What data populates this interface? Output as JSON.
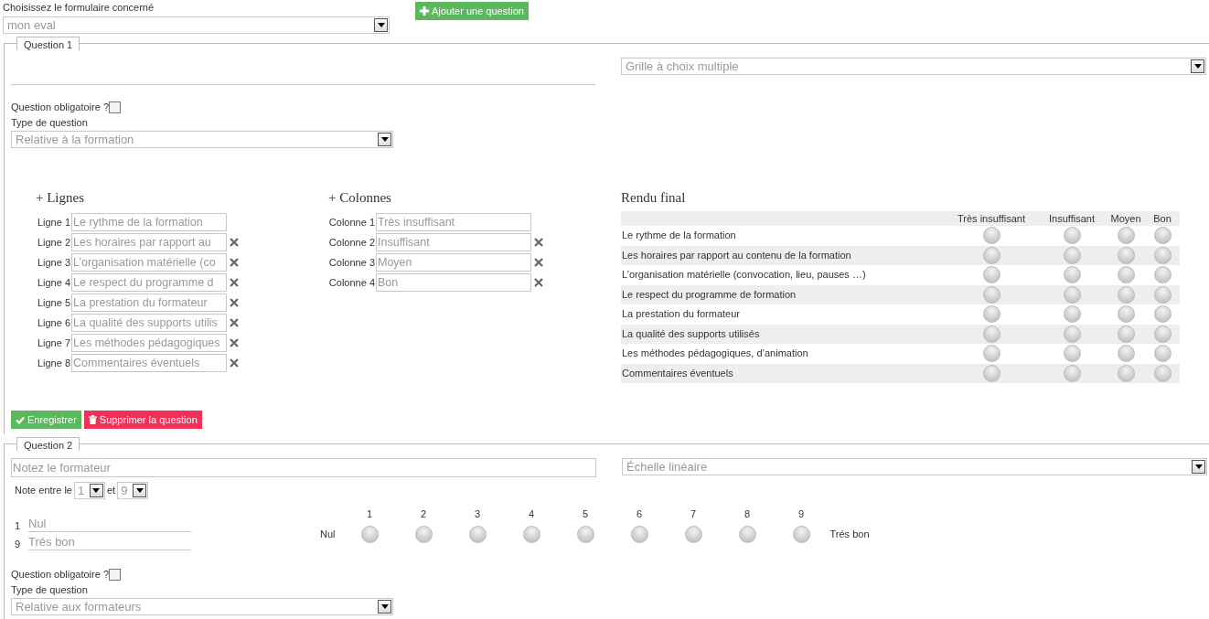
{
  "form_select": {
    "label": "Choisissez le formulaire concerné",
    "value": "mon eval"
  },
  "add_button": {
    "label": "Ajouter une question"
  },
  "questions": [
    {
      "legend": "Question 1",
      "kind": "grid",
      "type_select": "Grille à choix multiple",
      "required": {
        "label": "Question obligatoire ?",
        "checked": false
      },
      "category": {
        "label": "Type de question",
        "value": "Relative à la formation"
      },
      "lines": {
        "heading": "+ Lignes",
        "items": [
          {
            "label": "Ligne 1",
            "value": "Le rythme de la formation",
            "removable": false
          },
          {
            "label": "Ligne 2",
            "value": "Les horaires par rapport au",
            "removable": true
          },
          {
            "label": "Ligne 3",
            "value": "L’organisation matérielle (co",
            "removable": true
          },
          {
            "label": "Ligne 4",
            "value": "Le respect du programme d",
            "removable": true
          },
          {
            "label": "Ligne 5",
            "value": "La prestation du formateur",
            "removable": true
          },
          {
            "label": "Ligne 6",
            "value": "La qualité des supports utilis",
            "removable": true
          },
          {
            "label": "Ligne 7",
            "value": "Les méthodes pédagogiques",
            "removable": true
          },
          {
            "label": "Ligne 8",
            "value": "Commentaires éventuels",
            "removable": true
          }
        ]
      },
      "columns": {
        "heading": "+ Colonnes",
        "items": [
          {
            "label": "Colonne 1",
            "value": "Très insuffisant",
            "removable": false
          },
          {
            "label": "Colonne 2",
            "value": "Insuffisant",
            "removable": true
          },
          {
            "label": "Colonne 3",
            "value": "Moyen",
            "removable": true
          },
          {
            "label": "Colonne 4",
            "value": "Bon",
            "removable": true
          }
        ]
      },
      "preview": {
        "heading": "Rendu final",
        "columns": [
          "Très insuffisant",
          "Insuffisant",
          "Moyen",
          "Bon"
        ],
        "rows": [
          {
            "label": "Le rythme de la formation",
            "choices": [
              {
                "selected": false
              },
              {
                "selected": false
              },
              {
                "selected": false
              },
              {
                "selected": false
              }
            ]
          },
          {
            "label": "Les horaires par rapport au contenu de la formation",
            "choices": [
              {
                "selected": false
              },
              {
                "selected": false
              },
              {
                "selected": false
              },
              {
                "selected": false
              }
            ]
          },
          {
            "label": "L’organisation matérielle (convocation, lieu, pauses …)",
            "choices": [
              {
                "selected": false
              },
              {
                "selected": false
              },
              {
                "selected": false
              },
              {
                "selected": false
              }
            ]
          },
          {
            "label": "Le respect du programme de formation",
            "choices": [
              {
                "selected": false
              },
              {
                "selected": false
              },
              {
                "selected": false
              },
              {
                "selected": false
              }
            ]
          },
          {
            "label": "La prestation du formateur",
            "choices": [
              {
                "selected": false
              },
              {
                "selected": false
              },
              {
                "selected": false
              },
              {
                "selected": false
              }
            ]
          },
          {
            "label": "La qualité des supports utilisés",
            "choices": [
              {
                "selected": false
              },
              {
                "selected": false
              },
              {
                "selected": false
              },
              {
                "selected": false
              }
            ]
          },
          {
            "label": "Les méthodes pédagogiques, d’animation",
            "choices": [
              {
                "selected": false
              },
              {
                "selected": false
              },
              {
                "selected": false
              },
              {
                "selected": false
              }
            ]
          },
          {
            "label": "Commentaires éventuels",
            "choices": [
              {
                "selected": false
              },
              {
                "selected": false
              },
              {
                "selected": false
              },
              {
                "selected": false
              }
            ]
          }
        ]
      },
      "buttons": [
        {
          "kind": "save",
          "label": "Enregistrer"
        },
        {
          "kind": "delete",
          "label": "Supprimer la question"
        }
      ]
    },
    {
      "legend": "Question 2",
      "kind": "scale",
      "title": "Notez le formateur",
      "type_select": "Échelle linéaire",
      "range": {
        "label": "Note entre le",
        "min": "1",
        "joiner": "et",
        "max": "9"
      },
      "endpoints": [
        {
          "number": "1",
          "label": "Nul"
        },
        {
          "number": "9",
          "label": "Trés bon"
        }
      ],
      "scale_preview": {
        "low": "Nul",
        "points": [
          {
            "number": "1",
            "selected": false
          },
          {
            "number": "2",
            "selected": false
          },
          {
            "number": "3",
            "selected": false
          },
          {
            "number": "4",
            "selected": false
          },
          {
            "number": "5",
            "selected": false
          },
          {
            "number": "6",
            "selected": false
          },
          {
            "number": "7",
            "selected": false
          },
          {
            "number": "8",
            "selected": false
          },
          {
            "number": "9",
            "selected": false
          }
        ],
        "high": "Trés bon"
      },
      "required": {
        "label": "Question obligatoire ?",
        "checked": false
      },
      "category": {
        "label": "Type de question",
        "value": "Relative aux formateurs"
      }
    }
  ]
}
